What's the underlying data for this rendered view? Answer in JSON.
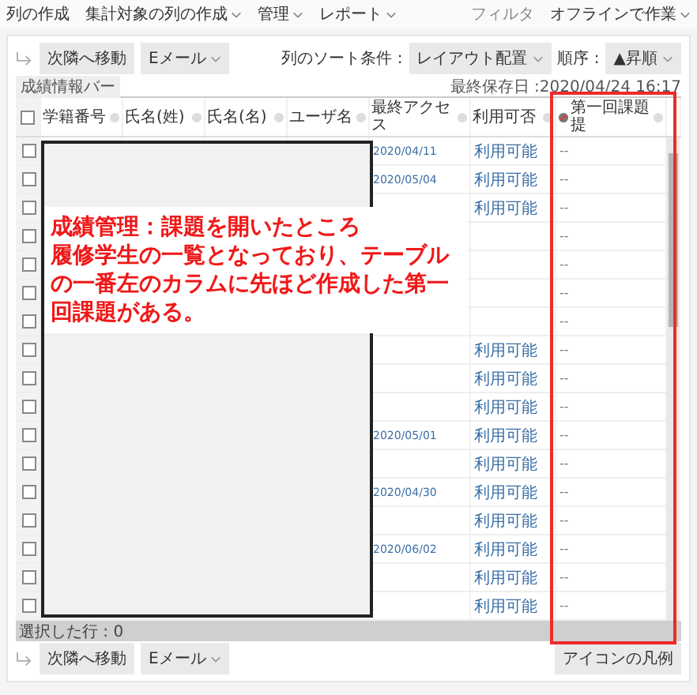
{
  "menu": [
    {
      "label": "列の作成",
      "dropdown": false
    },
    {
      "label": "集計対象の列の作成",
      "dropdown": true
    },
    {
      "label": "管理",
      "dropdown": true
    },
    {
      "label": "レポート",
      "dropdown": true
    }
  ],
  "right_menu": [
    {
      "label": "フィルタ",
      "dropdown": false
    },
    {
      "label": "オフラインで作業",
      "dropdown": true
    }
  ],
  "toolbar": {
    "buttons": [
      {
        "label": "次隣へ移動",
        "dropdown": false
      },
      {
        "label": "Eメール",
        "dropdown": true
      }
    ],
    "sort_label": "列のソート条件 :",
    "sort_value": "レイアウト配置",
    "order_label": "順序 :",
    "order_value": "▲昇順"
  },
  "info_bar": "成績情報バー",
  "last_saved": "最終保存日 :2020/04/24 16:17",
  "select_all_checked": false,
  "columns": [
    {
      "label": "学籍番号",
      "kind": "text"
    },
    {
      "label": "氏名(姓)",
      "kind": "text"
    },
    {
      "label": "氏名(名)",
      "kind": "text"
    },
    {
      "label": "ユーザ名",
      "kind": "text"
    },
    {
      "label": "最終アクセス",
      "kind": "text"
    },
    {
      "label": "利用可否",
      "kind": "text"
    },
    {
      "label": "第一回課題提",
      "kind": "graded"
    }
  ],
  "rows": [
    {
      "checked": false,
      "last_access": "2020/04/11",
      "availability": "利用可能",
      "grade": "--"
    },
    {
      "checked": false,
      "last_access": "2020/05/04",
      "availability": "利用可能",
      "grade": "--"
    },
    {
      "checked": false,
      "availability": "利用可能",
      "grade": "--"
    },
    {
      "checked": false,
      "grade": "--"
    },
    {
      "checked": false,
      "grade": "--"
    },
    {
      "checked": false,
      "grade": "--"
    },
    {
      "checked": false,
      "grade": "--"
    },
    {
      "checked": false,
      "availability": "利用可能",
      "grade": "--"
    },
    {
      "checked": false,
      "availability": "利用可能",
      "grade": "--"
    },
    {
      "checked": false,
      "availability": "利用可能",
      "grade": "--"
    },
    {
      "checked": false,
      "last_access": "2020/05/01",
      "availability": "利用可能",
      "grade": "--"
    },
    {
      "checked": false,
      "availability": "利用可能",
      "grade": "--"
    },
    {
      "checked": false,
      "last_access": "2020/04/30",
      "availability": "利用可能",
      "grade": "--"
    },
    {
      "checked": false,
      "availability": "利用可能",
      "grade": "--"
    },
    {
      "checked": false,
      "last_access": "2020/06/02",
      "availability": "利用可能",
      "grade": "--"
    },
    {
      "checked": false,
      "availability": "利用可能",
      "grade": "--"
    },
    {
      "checked": false,
      "availability": "利用可能",
      "grade": "--"
    }
  ],
  "selection_status": "選択した行 : 0",
  "bottom_buttons": [
    {
      "label": "次隣へ移動",
      "dropdown": false
    },
    {
      "label": "Eメール",
      "dropdown": true
    }
  ],
  "legend_button": "アイコンの凡例",
  "annotation": {
    "lines": [
      "成績管理：課題を開いたところ",
      "履修学生の一覧となっており、テーブル",
      "の一番左のカラムに先ほど作成した第一",
      "回課題がある。"
    ]
  }
}
